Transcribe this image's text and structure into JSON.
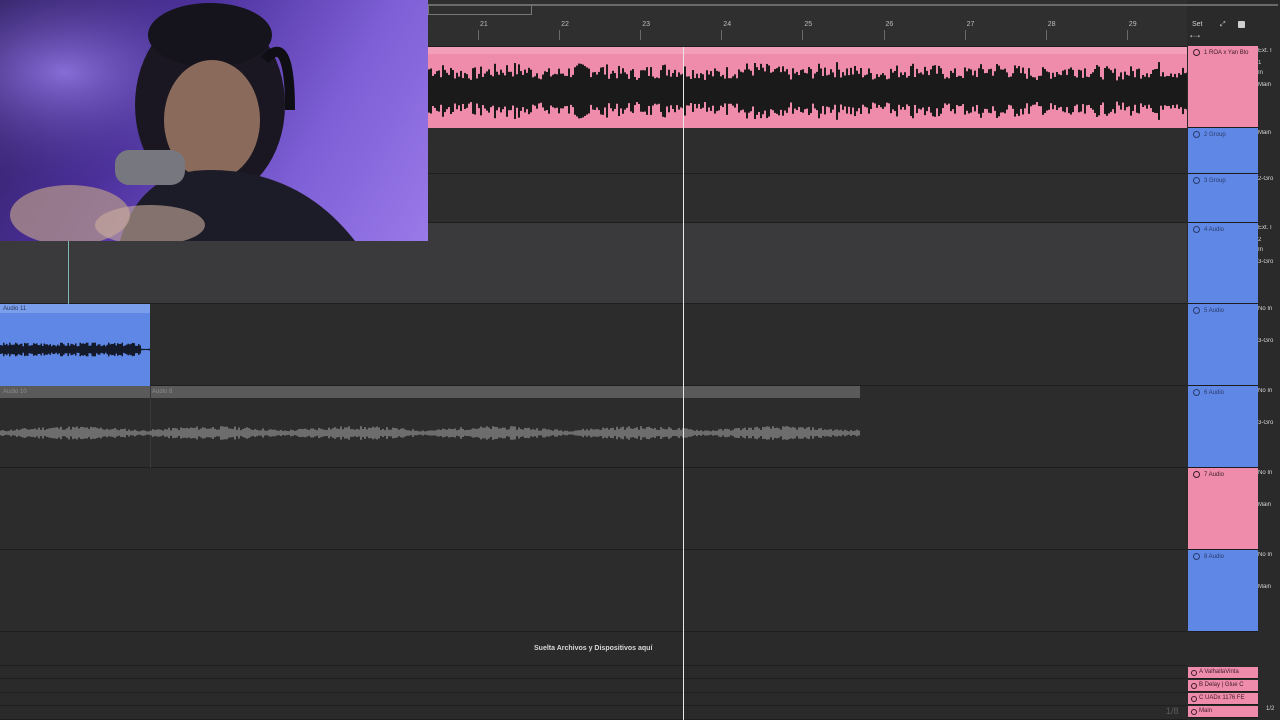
{
  "ruler": {
    "bars": [
      "21",
      "22",
      "23",
      "24",
      "25",
      "26",
      "27",
      "28",
      "29"
    ],
    "set_label": "Set"
  },
  "clips": {
    "audio11": "Audio 11",
    "audio10": "Audio 10",
    "audio8": "Audio 8"
  },
  "tracks": [
    {
      "name": "1 ROA x Yan Blo",
      "color": "#f08cab",
      "io": [
        "Ext. I",
        "1",
        "In",
        "Main"
      ]
    },
    {
      "name": "2 Group",
      "color": "#5f88e6",
      "io": [
        "Main"
      ]
    },
    {
      "name": "3 Group",
      "color": "#5f88e6",
      "io": [
        "2-Gro"
      ]
    },
    {
      "name": "4 Audio",
      "color": "#5f88e6",
      "io": [
        "Ext. I",
        "2",
        "In",
        "3-Gro"
      ]
    },
    {
      "name": "5 Audio",
      "color": "#5f88e6",
      "io": [
        "No In",
        "3-Gro"
      ]
    },
    {
      "name": "6 Audio",
      "color": "#5f88e6",
      "io": [
        "No In",
        "3-Gro"
      ]
    },
    {
      "name": "7 Audio",
      "color": "#f08cab",
      "io": [
        "No In",
        "Main"
      ]
    },
    {
      "name": "8 Audio",
      "color": "#5f88e6",
      "io": [
        "No In",
        "Main"
      ]
    }
  ],
  "returns": [
    "A ValhallaVinta",
    "B Delay | Glue C",
    "C UADx 1176 FE",
    "Main"
  ],
  "master_right": "1/2",
  "drop_text": "Suelta Archivos y Dispositivos aquí",
  "page_count": "1/8",
  "colors": {
    "pink": "#f08cab",
    "blue": "#5f88e6",
    "background": "#2b2b2b"
  }
}
